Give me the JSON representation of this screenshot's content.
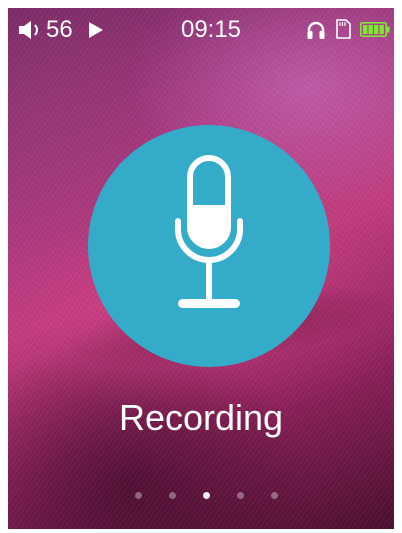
{
  "status_bar": {
    "volume_icon": "speaker-icon",
    "volume": "56",
    "play_icon": "play-icon",
    "time": "09:15",
    "headphone_icon": "headphone-icon",
    "sd_card_icon": "sd-card-icon",
    "battery_icon": "battery-icon",
    "battery_color": "#7ee832"
  },
  "main": {
    "icon": "microphone-icon",
    "circle_color": "#34acc9",
    "label": "Recording"
  },
  "pager": {
    "count": 5,
    "active_index": 2
  }
}
